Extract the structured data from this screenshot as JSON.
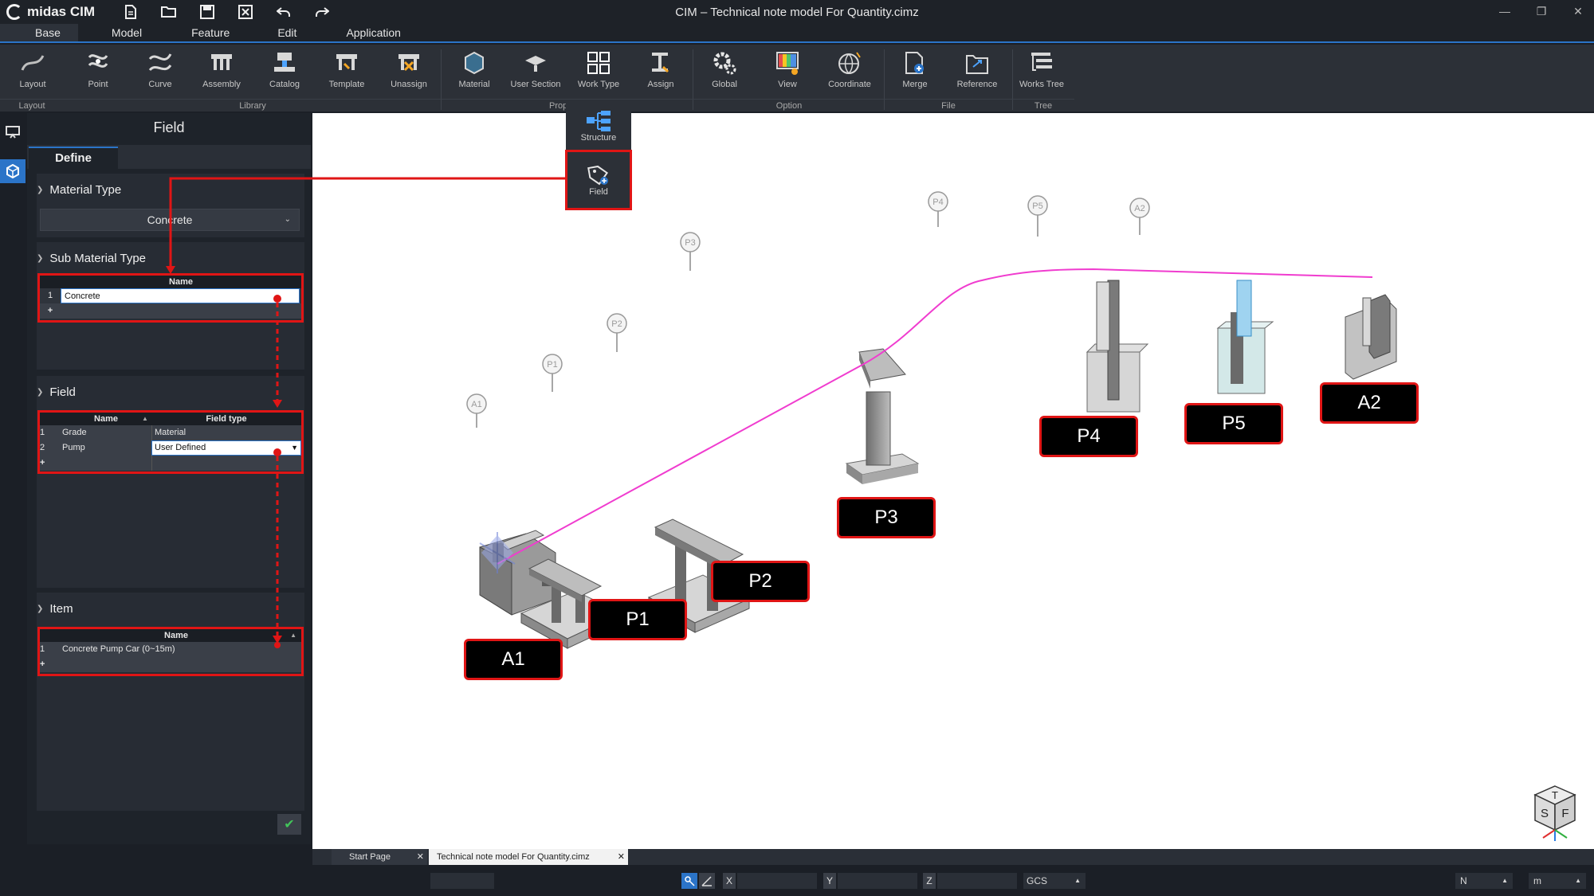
{
  "app": {
    "brand": "midas CIM",
    "window_title": "CIM – Technical note model For Quantity.cimz"
  },
  "menu_tabs": [
    {
      "label": "Base"
    },
    {
      "label": "Model"
    },
    {
      "label": "Feature"
    },
    {
      "label": "Edit"
    },
    {
      "label": "Application"
    }
  ],
  "ribbon": {
    "buttons": [
      {
        "label": "Layout"
      },
      {
        "label": "Point"
      },
      {
        "label": "Curve"
      },
      {
        "label": "Assembly"
      },
      {
        "label": "Catalog"
      },
      {
        "label": "Template"
      },
      {
        "label": "Unassign"
      },
      {
        "label": "Material"
      },
      {
        "label": "User Section"
      },
      {
        "label": "Work Type"
      },
      {
        "label": "Assign"
      },
      {
        "label": "Global"
      },
      {
        "label": "View"
      },
      {
        "label": "Coordinate"
      },
      {
        "label": "Merge"
      },
      {
        "label": "Reference"
      },
      {
        "label": "Works Tree"
      }
    ],
    "groups": [
      {
        "label": "Layout"
      },
      {
        "label": "Library"
      },
      {
        "label": "Prop"
      },
      {
        "label": "Option"
      },
      {
        "label": "File"
      },
      {
        "label": "Tree"
      }
    ],
    "worktype_dropdown": [
      {
        "label": "Structure"
      },
      {
        "label": "Field"
      }
    ]
  },
  "panel": {
    "title": "Field",
    "tab_define": "Define",
    "material_type": {
      "heading": "Material Type",
      "value": "Concrete"
    },
    "sub_material_type": {
      "heading": "Sub Material Type",
      "col_name": "Name",
      "rows": [
        {
          "num": "1",
          "name": "Concrete"
        }
      ],
      "add": "+"
    },
    "field": {
      "heading": "Field",
      "col_name": "Name",
      "col_type": "Field type",
      "rows": [
        {
          "num": "1",
          "name": "Grade",
          "type": "Material"
        },
        {
          "num": "2",
          "name": "Pump",
          "type": "User Defined"
        }
      ],
      "add": "+"
    },
    "item": {
      "heading": "Item",
      "col_name": "Name",
      "rows": [
        {
          "num": "1",
          "name": "Concrete Pump Car (0~15m)"
        }
      ],
      "add": "+"
    }
  },
  "viewport": {
    "markers": [
      {
        "label": "A1"
      },
      {
        "label": "P1"
      },
      {
        "label": "P2"
      },
      {
        "label": "P3"
      },
      {
        "label": "P4"
      },
      {
        "label": "P5"
      },
      {
        "label": "A2"
      }
    ],
    "callouts": [
      {
        "label": "A1"
      },
      {
        "label": "P1"
      },
      {
        "label": "P2"
      },
      {
        "label": "P3"
      },
      {
        "label": "P4"
      },
      {
        "label": "P5"
      },
      {
        "label": "A2"
      }
    ],
    "viewcube": {
      "top": "T",
      "left": "S",
      "right": "F"
    }
  },
  "doc_tabs": [
    {
      "label": "Start Page"
    },
    {
      "label": "Technical note model For Quantity.cimz"
    }
  ],
  "status": {
    "x_label": "X",
    "y_label": "Y",
    "z_label": "Z",
    "coord_system": "GCS",
    "force_unit": "N",
    "length_unit": "m"
  },
  "colors": {
    "accent": "#2b74c8",
    "highlight": "#e01515",
    "alignment": "#f03ccf",
    "confirm": "#42c45a"
  }
}
